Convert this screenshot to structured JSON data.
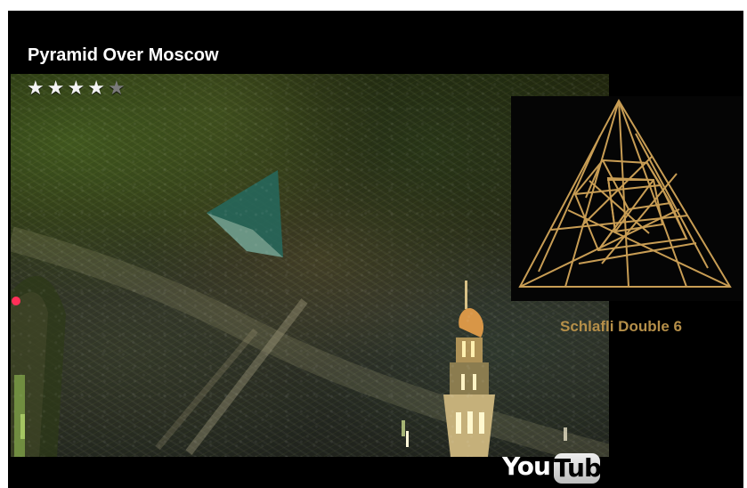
{
  "video": {
    "title": "Pyramid Over Moscow",
    "rating_value": 4,
    "rating_max": 5,
    "stars": [
      "★",
      "★",
      "★",
      "★",
      "★"
    ],
    "inset_caption": "Schlafli Double 6"
  },
  "branding": {
    "youtube_you": "You",
    "youtube_tube": "Tube"
  },
  "colors": {
    "player_background": "#000000",
    "diagram_stroke": "#c89d54",
    "caption_color": "#b58f49",
    "title_color": "#ffffff"
  },
  "icons": {
    "rating_star": "star-icon",
    "brand_logo": "youtube-logo"
  }
}
